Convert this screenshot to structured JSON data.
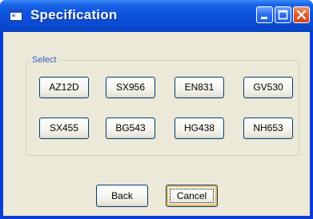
{
  "window": {
    "title": "Specification",
    "icons": {
      "app": "window-app-icon",
      "minimize": "minimize-icon",
      "maximize": "maximize-icon",
      "close": "close-icon"
    }
  },
  "group": {
    "label": "Select",
    "buttons": [
      {
        "label": "AZ12D"
      },
      {
        "label": "SX956"
      },
      {
        "label": "EN831"
      },
      {
        "label": "GV530"
      },
      {
        "label": "SX455"
      },
      {
        "label": "BG543"
      },
      {
        "label": "HG438"
      },
      {
        "label": "NH653"
      }
    ]
  },
  "actions": {
    "back_label": "Back",
    "cancel_label": "Cancel",
    "focused": "cancel"
  },
  "colors": {
    "titlebar": "#0a4ad0",
    "client_bg": "#ece9d8",
    "group_label": "#2e5fd0",
    "button_border": "#003c74",
    "close_button": "#e25a2c"
  }
}
